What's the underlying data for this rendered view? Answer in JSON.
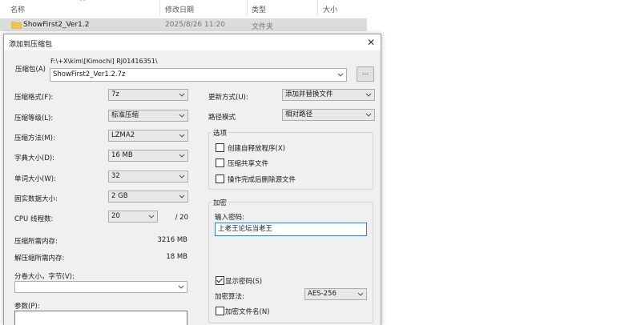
{
  "explorer": {
    "columns": [
      "名称",
      "修改日期",
      "类型",
      "大小"
    ],
    "file": {
      "name": "ShowFirst2_Ver1.2",
      "date": "2025/8/26 11:20",
      "type": "文件夹"
    }
  },
  "dialog": {
    "title": "添加到压缩包",
    "archive_label": "压缩包(A)",
    "archive_path": "F:\\+X\\kim\\[Kimochi] RJ01416351\\",
    "archive_name": "ShowFirst2_Ver1.2.7z",
    "browse_label": "...",
    "left": [
      {
        "label": "压缩格式(F):",
        "value": "7z"
      },
      {
        "label": "压缩等级(L):",
        "value": "标准压缩"
      },
      {
        "label": "压缩方法(M):",
        "value": "LZMA2"
      },
      {
        "label": "字典大小(D):",
        "value": "16 MB"
      },
      {
        "label": "单词大小(W):",
        "value": "32"
      },
      {
        "label": "固实数据大小:",
        "value": "2 GB"
      }
    ],
    "cpu_threads": {
      "label": "CPU 线程数:",
      "value": "20",
      "total": "/ 20"
    },
    "mem_compress": {
      "label": "压缩所需内存:",
      "value": "3216 MB"
    },
    "mem_decompress": {
      "label": "解压缩所需内存:",
      "value": "18 MB"
    },
    "volume_label": "分卷大小，字节(V):",
    "volume_value": "",
    "params_label": "参数(P):",
    "update_mode": {
      "label": "更新方式(U):",
      "value": "添加并替换文件"
    },
    "path_mode": {
      "label": "路径模式",
      "value": "相对路径"
    },
    "options": {
      "title": "选项",
      "items": [
        {
          "label": "创建自释放程序(X)",
          "checked": false
        },
        {
          "label": "压缩共享文件",
          "checked": false
        },
        {
          "label": "操作完成后删除源文件",
          "checked": false
        }
      ]
    },
    "encryption": {
      "title": "加密",
      "password_label": "输入密码:",
      "password_value": "上老王论坛当老王",
      "show_password": {
        "label": "显示密码(S)",
        "checked": true
      },
      "method_label": "加密算法:",
      "method_value": "AES-256",
      "encrypt_names": {
        "label": "加密文件名(N)",
        "checked": false
      }
    }
  }
}
